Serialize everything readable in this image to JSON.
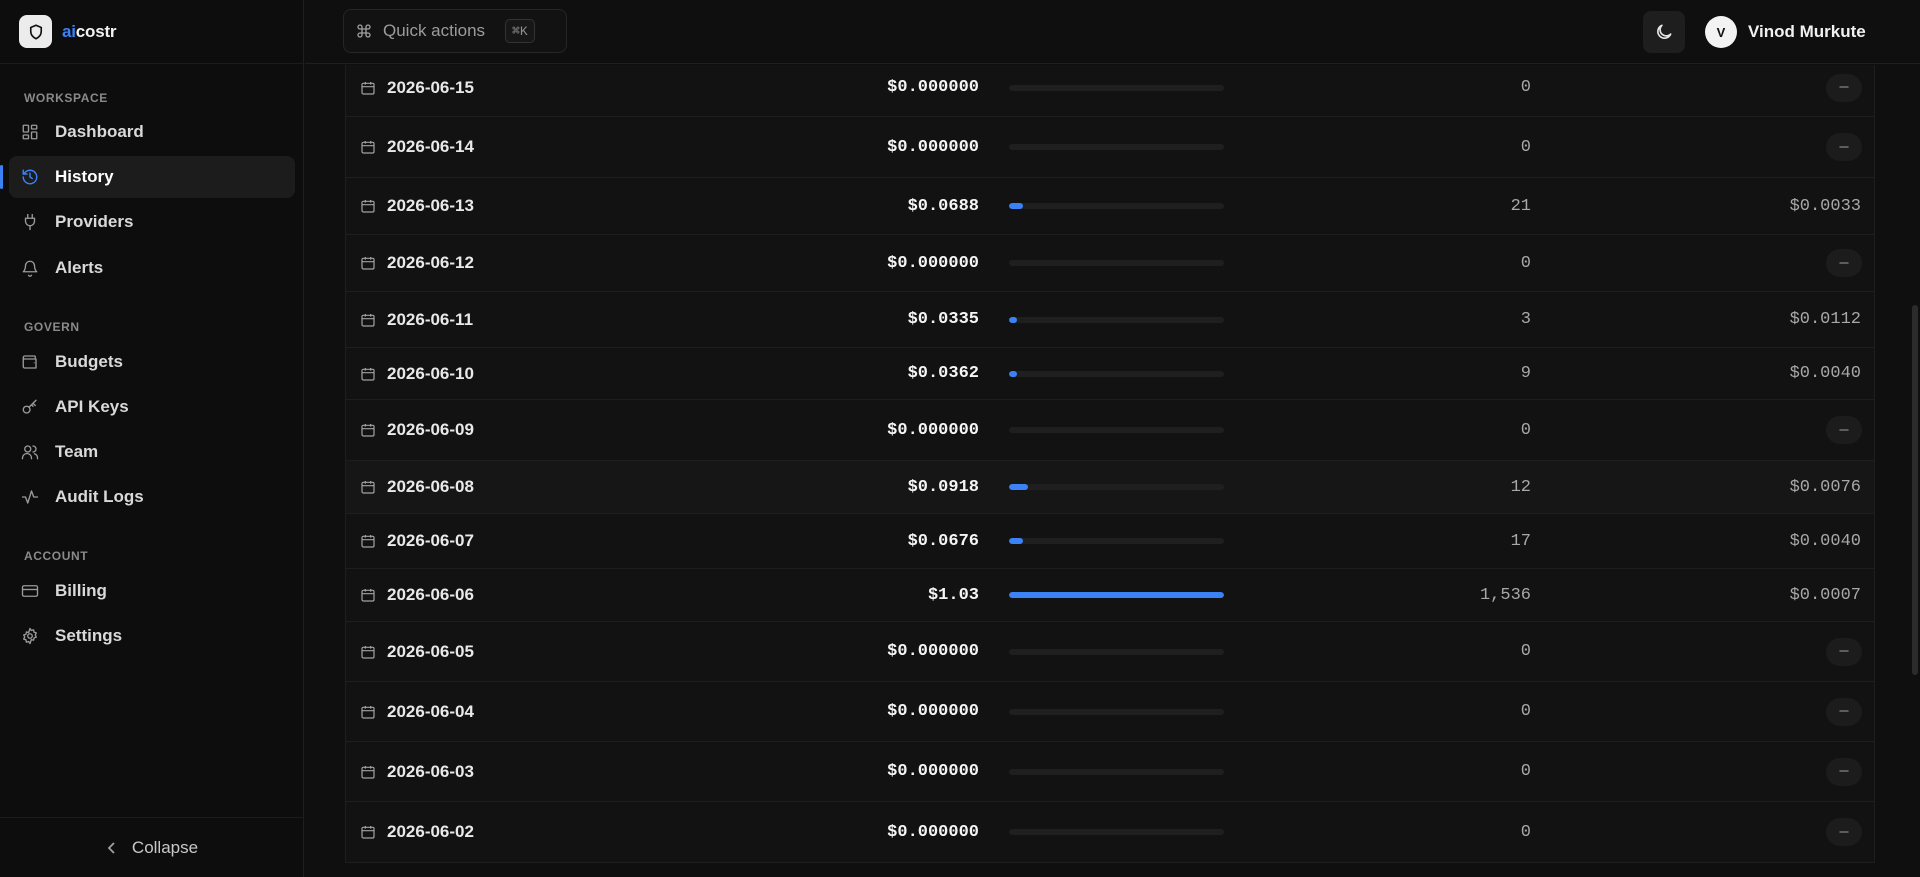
{
  "brand": {
    "prefix": "ai",
    "suffix": "costr"
  },
  "sidebar": {
    "sections": [
      {
        "label": "WORKSPACE",
        "items": [
          {
            "id": "dashboard",
            "label": "Dashboard",
            "icon": "grid-icon",
            "active": false
          },
          {
            "id": "history",
            "label": "History",
            "icon": "history-icon",
            "active": true
          },
          {
            "id": "providers",
            "label": "Providers",
            "icon": "plug-icon",
            "active": false
          },
          {
            "id": "alerts",
            "label": "Alerts",
            "icon": "bell-icon",
            "active": false
          }
        ]
      },
      {
        "label": "GOVERN",
        "items": [
          {
            "id": "budgets",
            "label": "Budgets",
            "icon": "wallet-icon",
            "active": false
          },
          {
            "id": "api-keys",
            "label": "API Keys",
            "icon": "key-icon",
            "active": false
          },
          {
            "id": "team",
            "label": "Team",
            "icon": "users-icon",
            "active": false
          },
          {
            "id": "audit-logs",
            "label": "Audit Logs",
            "icon": "activity-icon",
            "active": false
          }
        ]
      },
      {
        "label": "ACCOUNT",
        "items": [
          {
            "id": "billing",
            "label": "Billing",
            "icon": "credit-card-icon",
            "active": false
          },
          {
            "id": "settings",
            "label": "Settings",
            "icon": "gear-icon",
            "active": false
          }
        ]
      }
    ],
    "collapse_label": "Collapse"
  },
  "header": {
    "quick_actions_label": "Quick actions",
    "shortcut": "⌘K",
    "user": {
      "initial": "V",
      "name": "Vinod Murkute"
    }
  },
  "rows": [
    {
      "date": "2026-06-15",
      "cost": "$0.000000",
      "share": 0,
      "count": "0",
      "avg": null
    },
    {
      "date": "2026-06-14",
      "cost": "$0.000000",
      "share": 0,
      "count": "0",
      "avg": null
    },
    {
      "date": "2026-06-13",
      "cost": "$0.0688",
      "share": 0.067,
      "count": "21",
      "avg": "$0.0033"
    },
    {
      "date": "2026-06-12",
      "cost": "$0.000000",
      "share": 0,
      "count": "0",
      "avg": null
    },
    {
      "date": "2026-06-11",
      "cost": "$0.0335",
      "share": 0.033,
      "count": "3",
      "avg": "$0.0112"
    },
    {
      "date": "2026-06-10",
      "cost": "$0.0362",
      "share": 0.035,
      "count": "9",
      "avg": "$0.0040"
    },
    {
      "date": "2026-06-09",
      "cost": "$0.000000",
      "share": 0,
      "count": "0",
      "avg": null
    },
    {
      "date": "2026-06-08",
      "cost": "$0.0918",
      "share": 0.089,
      "count": "12",
      "avg": "$0.0076",
      "highlight": true
    },
    {
      "date": "2026-06-07",
      "cost": "$0.0676",
      "share": 0.066,
      "count": "17",
      "avg": "$0.0040"
    },
    {
      "date": "2026-06-06",
      "cost": "$1.03",
      "share": 1.0,
      "count": "1,536",
      "avg": "$0.0007"
    },
    {
      "date": "2026-06-05",
      "cost": "$0.000000",
      "share": 0,
      "count": "0",
      "avg": null
    },
    {
      "date": "2026-06-04",
      "cost": "$0.000000",
      "share": 0,
      "count": "0",
      "avg": null
    },
    {
      "date": "2026-06-03",
      "cost": "$0.000000",
      "share": 0,
      "count": "0",
      "avg": null
    },
    {
      "date": "2026-06-02",
      "cost": "$0.000000",
      "share": 0,
      "count": "0",
      "avg": null
    }
  ],
  "empty_avg_symbol": "—",
  "colors": {
    "accent": "#3b82f6",
    "background": "#0f0f0f",
    "surface": "#121212"
  }
}
